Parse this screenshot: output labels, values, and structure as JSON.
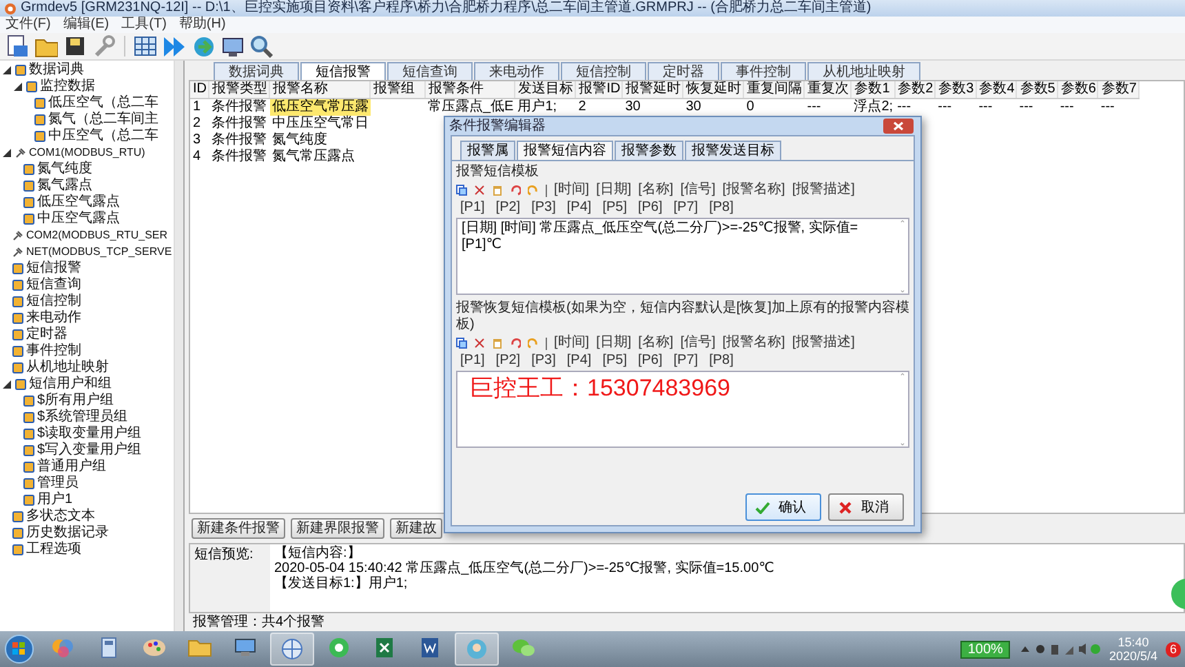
{
  "window": {
    "title": "Grmdev5 [GRM231NQ-12I] -- D:\\1、巨控实施项目资料\\客户程序\\桥力\\合肥桥力程序\\总二车间主管道.GRMPRJ -- (合肥桥力总二车间主管道)"
  },
  "menu": [
    "文件(F)",
    "编辑(E)",
    "工具(T)",
    "帮助(H)"
  ],
  "tree": [
    {
      "label": "数据词典",
      "expanded": true,
      "children": [
        {
          "label": "监控数据",
          "expanded": true,
          "children": [
            {
              "label": "低压空气（总二车"
            },
            {
              "label": "氮气（总二车间主"
            },
            {
              "label": "中压空气（总二车"
            }
          ]
        }
      ]
    },
    {
      "label": "COM1(MODBUS_RTU)",
      "kind": "port",
      "expanded": true,
      "children": [
        {
          "label": "氮气纯度"
        },
        {
          "label": "氮气露点"
        },
        {
          "label": "低压空气露点"
        },
        {
          "label": "中压空气露点"
        }
      ]
    },
    {
      "label": "COM2(MODBUS_RTU_SER",
      "kind": "port"
    },
    {
      "label": "NET(MODBUS_TCP_SERVE",
      "kind": "port"
    },
    {
      "label": "短信报警"
    },
    {
      "label": "短信查询"
    },
    {
      "label": "短信控制"
    },
    {
      "label": "来电动作"
    },
    {
      "label": "定时器"
    },
    {
      "label": "事件控制"
    },
    {
      "label": "从机地址映射"
    },
    {
      "label": "短信用户和组",
      "expanded": true,
      "children": [
        {
          "label": "$所有用户组"
        },
        {
          "label": "$系统管理员组"
        },
        {
          "label": "$读取变量用户组"
        },
        {
          "label": "$写入变量用户组"
        },
        {
          "label": "普通用户组"
        },
        {
          "label": "管理员"
        },
        {
          "label": "用户1"
        }
      ]
    },
    {
      "label": "多状态文本"
    },
    {
      "label": "历史数据记录"
    },
    {
      "label": "工程选项"
    }
  ],
  "tabs": [
    {
      "label": "数据词典",
      "selected": false
    },
    {
      "label": "短信报警",
      "selected": true
    },
    {
      "label": "短信查询",
      "selected": false
    },
    {
      "label": "来电动作",
      "selected": false
    },
    {
      "label": "短信控制",
      "selected": false
    },
    {
      "label": "定时器",
      "selected": false
    },
    {
      "label": "事件控制",
      "selected": false
    },
    {
      "label": "从机地址映射",
      "selected": false
    }
  ],
  "table": {
    "columns": [
      "ID",
      "报警类型",
      "报警名称",
      "报警组",
      "报警条件",
      "发送目标",
      "报警ID",
      "报警延时",
      "恢复延时",
      "重复间隔",
      "重复次",
      "参数1",
      "参数2",
      "参数3",
      "参数4",
      "参数5",
      "参数6",
      "参数7"
    ],
    "rows": [
      {
        "selected": true,
        "cells": [
          "1",
          "条件报警",
          "低压空气常压露",
          null,
          "常压露点_低E",
          "用户1;",
          "2",
          "30",
          "30",
          "0",
          "---",
          "浮点2;",
          "---",
          "---",
          "---",
          "---",
          "---",
          "---"
        ]
      },
      {
        "selected": false,
        "cells": [
          "2",
          "条件报警",
          "中压压空气常日"
        ]
      },
      {
        "selected": false,
        "cells": [
          "3",
          "条件报警",
          "氮气纯度"
        ]
      },
      {
        "selected": false,
        "cells": [
          "4",
          "条件报警",
          "氮气常压露点"
        ]
      }
    ]
  },
  "actions": [
    "新建条件报警",
    "新建界限报警",
    "新建故"
  ],
  "preview": {
    "label": "短信预览:",
    "lines": [
      "【短信内容:】",
      "2020-05-04 15:40:42 常压露点_低压空气(总二分厂)>=-25℃报警, 实际值=15.00℃",
      "【发送目标1:】用户1;"
    ]
  },
  "status_bar": "报警管理：共4个报警",
  "dialog": {
    "title": "条件报警编辑器",
    "tabs": [
      {
        "label": "报警属",
        "selected": false
      },
      {
        "label": "报警短信内容",
        "selected": true
      },
      {
        "label": "报警参数",
        "selected": false
      },
      {
        "label": "报警发送目标",
        "selected": false
      }
    ],
    "sections": [
      {
        "kind": "plain",
        "label": "报警短信模板",
        "tokens": [
          "[时间]",
          "[日期]",
          "[名称]",
          "[信号]",
          "[报警名称]",
          "[报警描述]"
        ],
        "params": [
          "[P1]",
          "[P2]",
          "[P3]",
          "[P4]",
          "[P5]",
          "[P6]",
          "[P7]",
          "[P8]"
        ],
        "value": "[日期] [时间] 常压露点_低压空气(总二分厂)>=-25℃报警, 实际值=[P1]℃"
      },
      {
        "kind": "large-red",
        "label": "报警恢复短信模板(如果为空，短信内容默认是[恢复]加上原有的报警内容模板)",
        "tokens": [
          "[时间]",
          "[日期]",
          "[名称]",
          "[信号]",
          "[报警名称]",
          "[报警描述]"
        ],
        "params": [
          "[P1]",
          "[P2]",
          "[P3]",
          "[P4]",
          "[P5]",
          "[P6]",
          "[P7]",
          "[P8]"
        ],
        "value": "巨控王工：15307483969"
      }
    ],
    "buttons": [
      {
        "kind": "ok",
        "label": "确认"
      },
      {
        "kind": "cancel",
        "label": "取消"
      }
    ]
  },
  "taskbar": {
    "battery": "100%",
    "time": "15:40",
    "date": "2020/5/4",
    "badge": "6"
  }
}
